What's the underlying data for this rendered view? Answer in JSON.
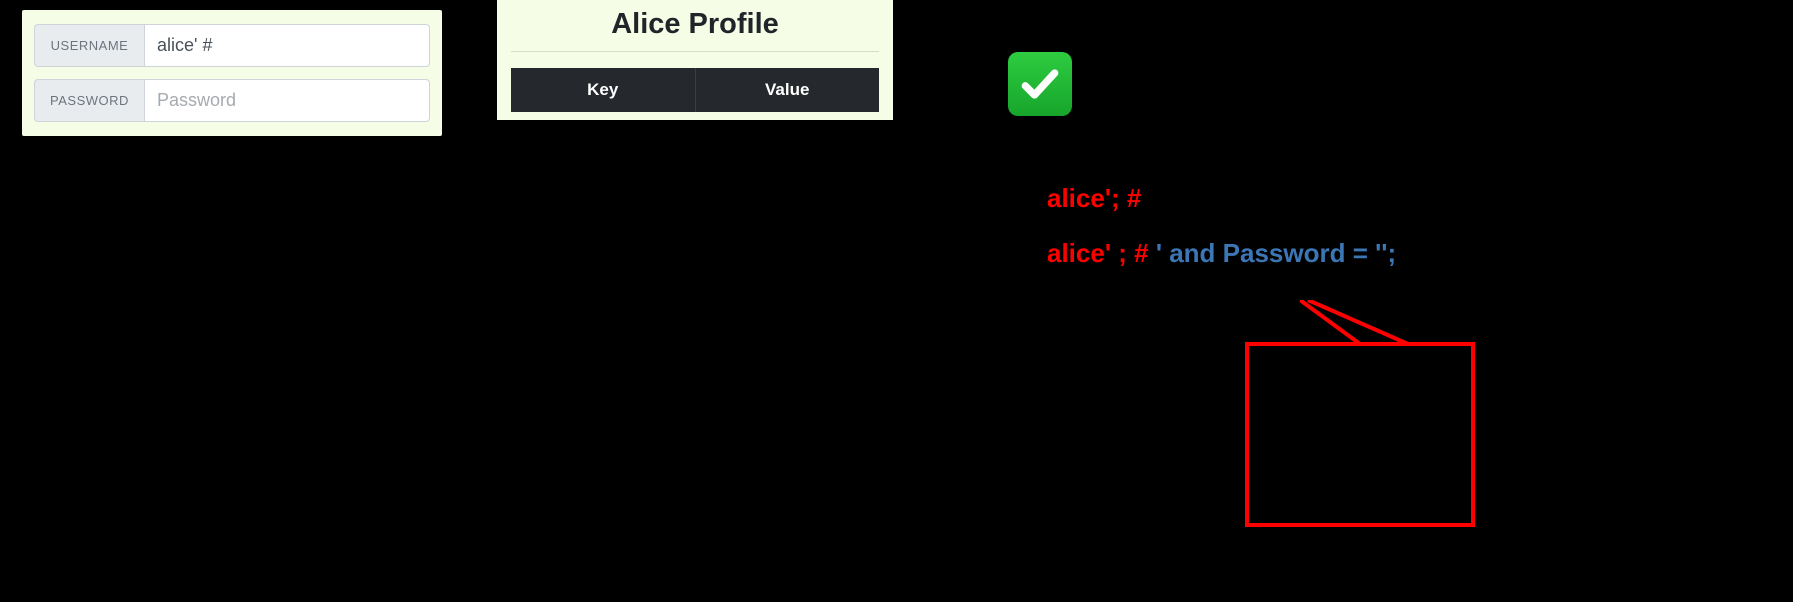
{
  "login": {
    "username_label": "USERNAME",
    "username_value": "alice' #",
    "password_label": "PASSWORD",
    "password_placeholder": "Password"
  },
  "profile": {
    "title": "Alice Profile",
    "columns": {
      "key": "Key",
      "value": "Value"
    }
  },
  "annot": {
    "line1": "alice'; #",
    "line2_red": "alice' ; # ",
    "line2_blue": " ' and Password = '';"
  }
}
